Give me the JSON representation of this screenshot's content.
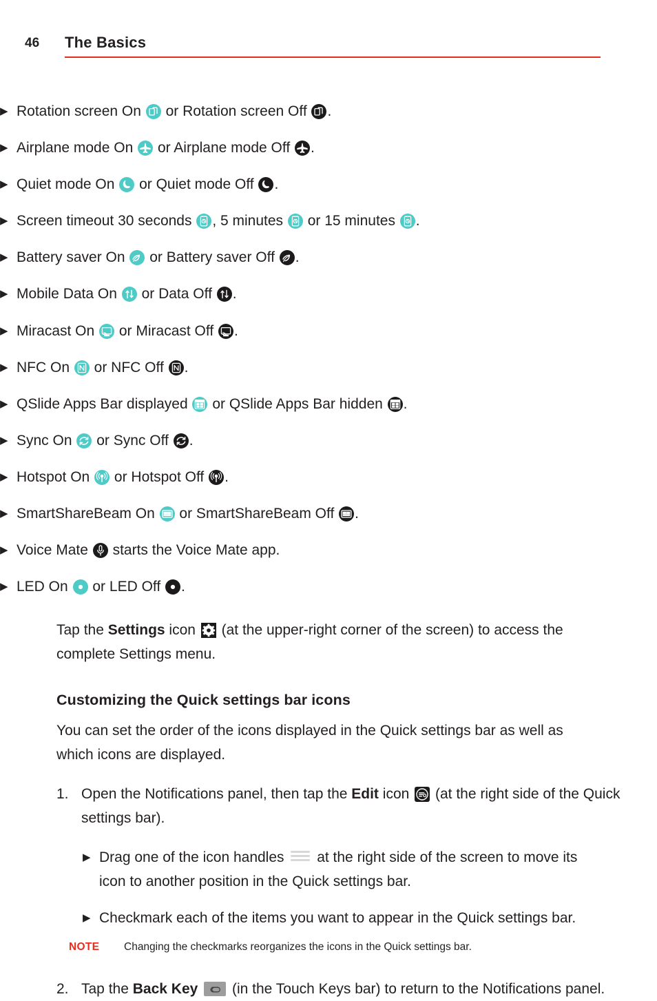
{
  "header": {
    "page_number": "46",
    "title": "The Basics",
    "rule_color": "#e8291c"
  },
  "colors": {
    "accent_red": "#e8291c",
    "icon_on_teal": "#4ecbc6",
    "icon_off_dark": "#1c1a1b",
    "text": "#231f20",
    "handle_grey": "#d8d8d8",
    "backkey_grey": "#9d9d9d"
  },
  "bullet_marker": "▶",
  "quick_settings_bullets": [
    {
      "id": "rotation",
      "parts": [
        {
          "type": "text",
          "value": "Rotation screen On "
        },
        {
          "type": "icon",
          "state": "on",
          "icon": "rotation-screen-icon"
        },
        {
          "type": "text",
          "value": " or Rotation screen Off "
        },
        {
          "type": "icon",
          "state": "off",
          "icon": "rotation-screen-icon"
        },
        {
          "type": "text",
          "value": "."
        }
      ]
    },
    {
      "id": "airplane",
      "parts": [
        {
          "type": "text",
          "value": "Airplane mode On "
        },
        {
          "type": "icon",
          "state": "on",
          "icon": "airplane-icon"
        },
        {
          "type": "text",
          "value": " or Airplane mode Off "
        },
        {
          "type": "icon",
          "state": "off",
          "icon": "airplane-icon"
        },
        {
          "type": "text",
          "value": "."
        }
      ]
    },
    {
      "id": "quiet",
      "parts": [
        {
          "type": "text",
          "value": "Quiet mode On "
        },
        {
          "type": "icon",
          "state": "on",
          "icon": "moon-icon"
        },
        {
          "type": "text",
          "value": " or Quiet mode Off "
        },
        {
          "type": "icon",
          "state": "off",
          "icon": "moon-icon"
        },
        {
          "type": "text",
          "value": "."
        }
      ]
    },
    {
      "id": "screen-timeout",
      "parts": [
        {
          "type": "text",
          "value": "Screen timeout 30 seconds "
        },
        {
          "type": "icon",
          "state": "on",
          "icon": "screen-timeout-icon"
        },
        {
          "type": "text",
          "value": ", 5 minutes "
        },
        {
          "type": "icon",
          "state": "on",
          "icon": "screen-timeout-icon"
        },
        {
          "type": "text",
          "value": " or 15 minutes "
        },
        {
          "type": "icon",
          "state": "on",
          "icon": "screen-timeout-icon"
        },
        {
          "type": "text",
          "value": "."
        }
      ]
    },
    {
      "id": "battery-saver",
      "parts": [
        {
          "type": "text",
          "value": "Battery saver On "
        },
        {
          "type": "icon",
          "state": "on",
          "icon": "battery-saver-icon"
        },
        {
          "type": "text",
          "value": " or Battery saver Off "
        },
        {
          "type": "icon",
          "state": "off",
          "icon": "battery-saver-icon"
        },
        {
          "type": "text",
          "value": "."
        }
      ]
    },
    {
      "id": "mobile-data",
      "parts": [
        {
          "type": "text",
          "value": "Mobile Data On "
        },
        {
          "type": "icon",
          "state": "on",
          "icon": "mobile-data-icon"
        },
        {
          "type": "text",
          "value": " or Data Off "
        },
        {
          "type": "icon",
          "state": "off",
          "icon": "mobile-data-icon"
        },
        {
          "type": "text",
          "value": "."
        }
      ]
    },
    {
      "id": "miracast",
      "parts": [
        {
          "type": "text",
          "value": "Miracast On "
        },
        {
          "type": "icon",
          "state": "on",
          "icon": "miracast-icon"
        },
        {
          "type": "text",
          "value": " or Miracast Off "
        },
        {
          "type": "icon",
          "state": "off",
          "icon": "miracast-icon"
        },
        {
          "type": "text",
          "value": "."
        }
      ]
    },
    {
      "id": "nfc",
      "parts": [
        {
          "type": "text",
          "value": "NFC On "
        },
        {
          "type": "icon",
          "state": "on",
          "icon": "nfc-icon"
        },
        {
          "type": "text",
          "value": " or NFC Off "
        },
        {
          "type": "icon",
          "state": "off",
          "icon": "nfc-icon"
        },
        {
          "type": "text",
          "value": "."
        }
      ]
    },
    {
      "id": "qslide",
      "parts": [
        {
          "type": "text",
          "value": "QSlide Apps Bar displayed "
        },
        {
          "type": "icon",
          "state": "on",
          "icon": "qslide-icon"
        },
        {
          "type": "text",
          "value": " or QSlide Apps Bar hidden "
        },
        {
          "type": "icon",
          "state": "off",
          "icon": "qslide-icon"
        },
        {
          "type": "text",
          "value": "."
        }
      ]
    },
    {
      "id": "sync",
      "parts": [
        {
          "type": "text",
          "value": "Sync On "
        },
        {
          "type": "icon",
          "state": "on",
          "icon": "sync-icon"
        },
        {
          "type": "text",
          "value": " or Sync Off "
        },
        {
          "type": "icon",
          "state": "off",
          "icon": "sync-icon"
        },
        {
          "type": "text",
          "value": "."
        }
      ]
    },
    {
      "id": "hotspot",
      "parts": [
        {
          "type": "text",
          "value": "Hotspot On "
        },
        {
          "type": "icon",
          "state": "on",
          "icon": "hotspot-icon"
        },
        {
          "type": "text",
          "value": " or Hotspot Off "
        },
        {
          "type": "icon",
          "state": "off",
          "icon": "hotspot-icon"
        },
        {
          "type": "text",
          "value": "."
        }
      ]
    },
    {
      "id": "smartsharebeam",
      "parts": [
        {
          "type": "text",
          "value": "SmartShareBeam On "
        },
        {
          "type": "icon",
          "state": "on",
          "icon": "smartsharebeam-icon"
        },
        {
          "type": "text",
          "value": " or SmartShareBeam Off "
        },
        {
          "type": "icon",
          "state": "off",
          "icon": "smartsharebeam-icon"
        },
        {
          "type": "text",
          "value": "."
        }
      ]
    },
    {
      "id": "voice-mate",
      "parts": [
        {
          "type": "text",
          "value": "Voice Mate "
        },
        {
          "type": "icon",
          "state": "off",
          "icon": "microphone-icon"
        },
        {
          "type": "text",
          "value": " starts the Voice Mate app."
        }
      ]
    },
    {
      "id": "led",
      "parts": [
        {
          "type": "text",
          "value": "LED On "
        },
        {
          "type": "icon",
          "state": "on",
          "icon": "led-icon"
        },
        {
          "type": "text",
          "value": " or LED Off "
        },
        {
          "type": "icon",
          "state": "off",
          "icon": "led-icon"
        },
        {
          "type": "text",
          "value": "."
        }
      ]
    }
  ],
  "settings_paragraph": {
    "before": "Tap the ",
    "bold": "Settings",
    "mid": " icon ",
    "icon": "gear-icon",
    "after": " (at the upper-right corner of the screen) to access the complete Settings menu."
  },
  "section": {
    "heading": "Customizing the Quick settings bar icons",
    "intro": "You can set the order of the icons displayed in the Quick settings bar as well as which icons are displayed."
  },
  "steps": [
    {
      "number": "1.",
      "before": "Open the Notifications panel, then tap the ",
      "bold": "Edit",
      "mid": " icon ",
      "icon": "edit-icon",
      "after": " (at the right side of the Quick settings bar)."
    },
    {
      "number": "2.",
      "before": "Tap the ",
      "bold": "Back Key",
      "mid": " ",
      "icon": "back-key-icon",
      "after": " (in the Touch Keys bar) to return to the Notifications panel."
    }
  ],
  "sub_bullets": [
    {
      "id": "drag-handles",
      "before": "Drag one of the icon handles ",
      "icon": "drag-handle-icon",
      "after": " at the right side of the screen to move its icon to another position in the Quick settings bar."
    },
    {
      "id": "checkmark-items",
      "before": "Checkmark each of the items you want to appear in the Quick settings bar.",
      "icon": null,
      "after": ""
    }
  ],
  "note": {
    "label": "NOTE",
    "text": "Changing the checkmarks reorganizes the icons in the Quick settings bar."
  }
}
